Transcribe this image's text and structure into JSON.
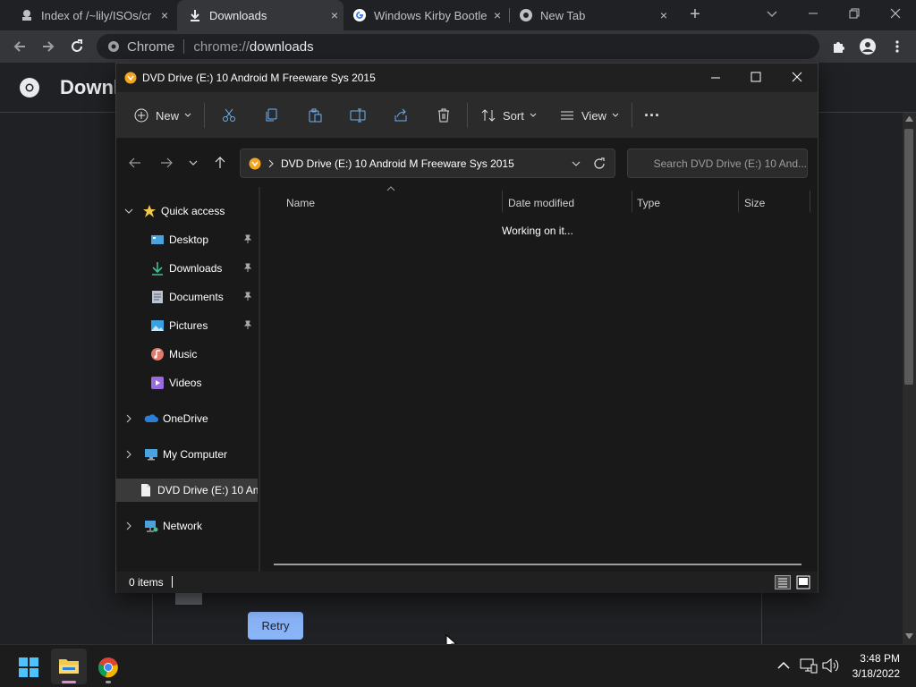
{
  "browser": {
    "tabs": [
      {
        "title": "Index of /~lily/ISOs/cr",
        "close": "×"
      },
      {
        "title": "Downloads",
        "close": "×"
      },
      {
        "title": "Windows Kirby Bootle",
        "close": "×"
      },
      {
        "title": "New Tab",
        "close": "×"
      }
    ],
    "new_tab": "+",
    "omnibox": {
      "label": "Chrome",
      "scheme": "chrome://",
      "host": "downloads"
    }
  },
  "downloads_page": {
    "title": "Downl",
    "retry_label": "Retry"
  },
  "explorer": {
    "title": "DVD Drive (E:) 10 Android M Freeware Sys 2015",
    "commands": {
      "new": "New",
      "sort": "Sort",
      "view": "View",
      "more": "···"
    },
    "address": "DVD Drive (E:) 10 Android M Freeware Sys 2015",
    "search_placeholder": "Search DVD Drive (E:) 10 And...",
    "nav": {
      "quick_access": "Quick access",
      "items": [
        {
          "label": "Desktop",
          "pinned": true,
          "icon": "desktop-icon",
          "color": "#4aa3df"
        },
        {
          "label": "Downloads",
          "pinned": true,
          "icon": "download-icon",
          "color": "#3ec28f"
        },
        {
          "label": "Documents",
          "pinned": true,
          "icon": "document-icon",
          "color": "#b9c4d0"
        },
        {
          "label": "Pictures",
          "pinned": true,
          "icon": "pictures-icon",
          "color": "#3aa0e0"
        },
        {
          "label": "Music",
          "pinned": false,
          "icon": "music-icon",
          "color": "#e07a6b"
        },
        {
          "label": "Videos",
          "pinned": false,
          "icon": "videos-icon",
          "color": "#9a6bdc"
        }
      ],
      "onedrive": "OneDrive",
      "my_computer": "My Computer",
      "dvd_drive": "DVD Drive (E:) 10 An",
      "network": "Network"
    },
    "columns": {
      "name": "Name",
      "date_modified": "Date modified",
      "type": "Type",
      "size": "Size"
    },
    "status_message": "Working on it...",
    "item_count": "0 items"
  },
  "taskbar": {
    "time": "3:48 PM",
    "date": "3/18/2022"
  },
  "colors": {
    "accent": "#8ab4f8",
    "explorer_bg": "#191919",
    "star": "#f2c94c",
    "window_controls_icon": "#ffffff"
  }
}
